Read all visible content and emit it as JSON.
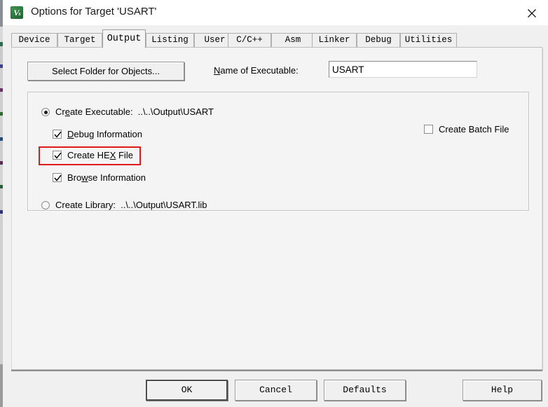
{
  "window": {
    "title": "Options for Target 'USART'",
    "icon_name": "uvision-logo-icon",
    "close_label": "✕"
  },
  "tabs": [
    {
      "label": "Device",
      "active": false
    },
    {
      "label": "Target",
      "active": false
    },
    {
      "label": "Output",
      "active": true
    },
    {
      "label": "Listing",
      "active": false
    },
    {
      "label": "User",
      "active": false
    },
    {
      "label": "C/C++",
      "active": false
    },
    {
      "label": "Asm",
      "active": false
    },
    {
      "label": "Linker",
      "active": false
    },
    {
      "label": "Debug",
      "active": false
    },
    {
      "label": "Utilities",
      "active": false
    }
  ],
  "output_tab": {
    "select_folder_button": "Select Folder for Objects...",
    "name_of_executable_label": "Name of Executable:",
    "name_of_executable_value": "USART",
    "create_executable": {
      "label": "Create Executable:",
      "path": "..\\..\\Output\\USART",
      "selected": true
    },
    "debug_information": {
      "label": "Debug Information",
      "checked": true
    },
    "create_hex_file": {
      "label": "Create HEX File",
      "checked": true,
      "highlighted": true,
      "highlight_color": "#e01b1b"
    },
    "browse_information": {
      "label": "Browse Information",
      "checked": true
    },
    "create_batch_file": {
      "label": "Create Batch File",
      "checked": false
    },
    "create_library": {
      "label": "Create Library:",
      "path": "..\\..\\Output\\USART.lib",
      "selected": false
    }
  },
  "footer": {
    "ok": "OK",
    "cancel": "Cancel",
    "defaults": "Defaults",
    "help": "Help"
  }
}
